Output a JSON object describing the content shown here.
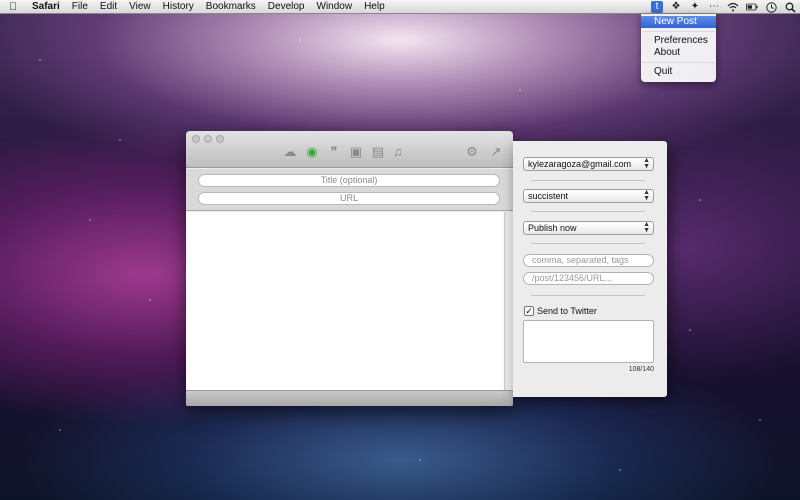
{
  "menubar": {
    "apple_icon": "apple-icon",
    "items": [
      "Safari",
      "File",
      "Edit",
      "View",
      "History",
      "Bookmarks",
      "Develop",
      "Window",
      "Help"
    ],
    "status_icons": [
      "tumblr-icon",
      "dropbox-icon",
      "twitter-icon",
      "ellipsis-icon",
      "wifi-icon",
      "battery-icon",
      "clock-icon",
      "spotlight-icon"
    ]
  },
  "menu": {
    "items": [
      "New Post",
      "Preferences",
      "About",
      "Quit"
    ],
    "highlighted": "New Post",
    "highlight_color": "#3b6fd8"
  },
  "editor_window": {
    "toolbar_icons": [
      "text-post-icon",
      "photo-post-icon",
      "quote-post-icon",
      "link-post-icon",
      "chat-post-icon",
      "audio-post-icon",
      "video-post-icon",
      "settings-icon",
      "share-icon"
    ],
    "selected_icon": "photo-post-icon",
    "title_placeholder": "Title (optional)",
    "url_placeholder": "URL"
  },
  "publish_panel": {
    "account": "kylezaragoza@gmail.com",
    "blog": "succistent",
    "publish_option": "Publish now",
    "tags_placeholder": "comma, separated, tags",
    "custom_url_placeholder": "/post/123456/URL...",
    "send_to_twitter_label": "Send to Twitter",
    "send_to_twitter_checked": true,
    "char_counter": "108/140"
  }
}
